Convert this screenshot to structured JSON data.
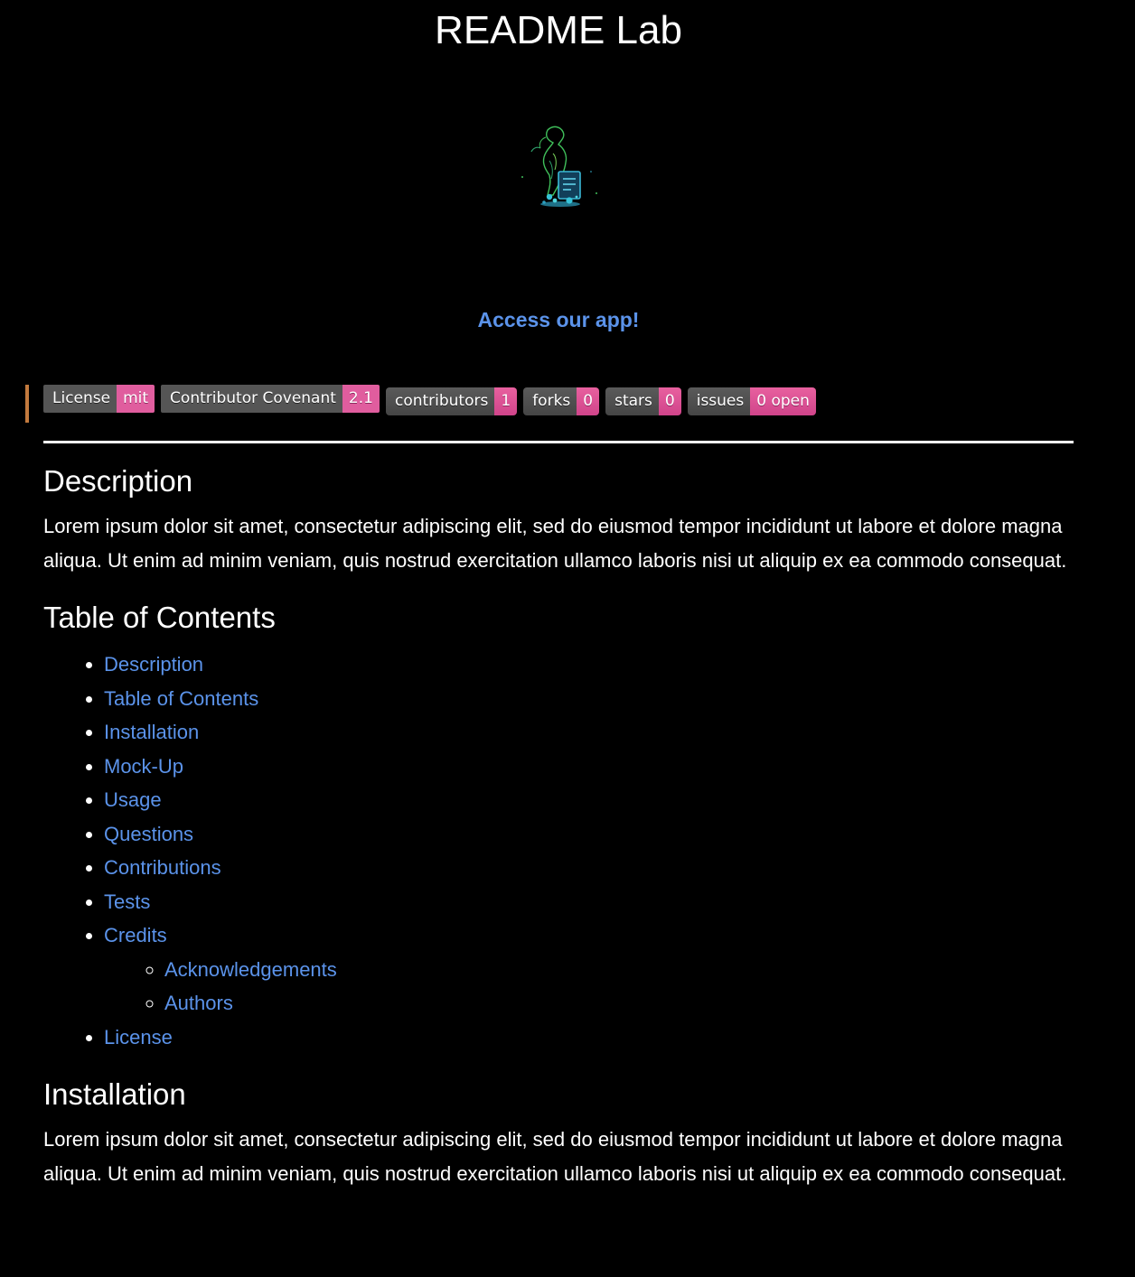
{
  "header": {
    "title": "README Lab",
    "logo_icon": "readme-lab-logo-icon",
    "app_link": "Access our app!"
  },
  "badges": [
    {
      "label": "License",
      "value": "mit",
      "style": "flat"
    },
    {
      "label": "Contributor Covenant",
      "value": "2.1",
      "style": "flat"
    },
    {
      "label": "contributors",
      "value": "1",
      "style": "plastic"
    },
    {
      "label": "forks",
      "value": "0",
      "style": "plastic"
    },
    {
      "label": "stars",
      "value": "0",
      "style": "plastic"
    },
    {
      "label": "issues",
      "value": "0 open",
      "style": "plastic"
    }
  ],
  "colors": {
    "background": "#000000",
    "link": "#5b93ea",
    "badge_value": "#e05d9e",
    "badge_label": "#555555",
    "blockquote_border": "#c37a3e"
  },
  "description": {
    "heading": "Description",
    "text": "Lorem ipsum dolor sit amet, consectetur adipiscing elit, sed do eiusmod tempor incididunt ut labore et dolore magna aliqua. Ut enim ad minim veniam, quis nostrud exercitation ullamco laboris nisi ut aliquip ex ea commodo consequat."
  },
  "toc": {
    "heading": "Table of Contents",
    "items": [
      {
        "label": "Description"
      },
      {
        "label": "Table of Contents"
      },
      {
        "label": "Installation"
      },
      {
        "label": "Mock-Up"
      },
      {
        "label": "Usage"
      },
      {
        "label": "Questions"
      },
      {
        "label": "Contributions"
      },
      {
        "label": "Tests"
      },
      {
        "label": "Credits",
        "children": [
          {
            "label": "Acknowledgements"
          },
          {
            "label": "Authors"
          }
        ]
      },
      {
        "label": "License"
      }
    ]
  },
  "installation": {
    "heading": "Installation",
    "text": "Lorem ipsum dolor sit amet, consectetur adipiscing elit, sed do eiusmod tempor incididunt ut labore et dolore magna aliqua. Ut enim ad minim veniam, quis nostrud exercitation ullamco laboris nisi ut aliquip ex ea commodo consequat."
  }
}
